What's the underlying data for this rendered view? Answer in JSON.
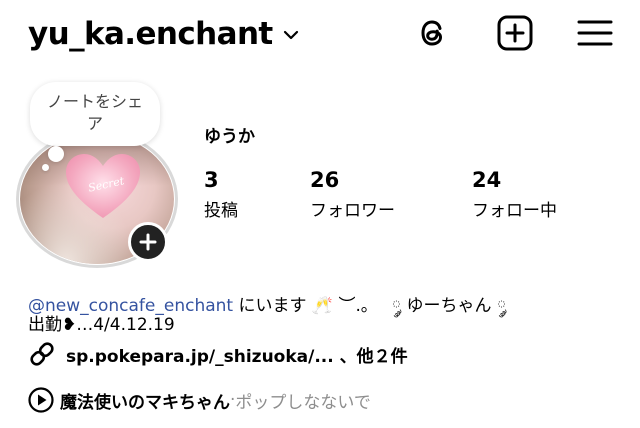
{
  "header": {
    "username": "yu_ka.enchant",
    "icons": [
      "chevron-down-icon",
      "threads-icon",
      "create-plus-icon",
      "menu-icon"
    ]
  },
  "note": {
    "line1": "ノートをシェ",
    "line2": "ア"
  },
  "avatar": {
    "overlay_text": "Secret",
    "add_story_icon": "plus-icon"
  },
  "profile": {
    "display_name": "ゆうか",
    "stats": [
      {
        "value": "3",
        "label": "投稿"
      },
      {
        "value": "26",
        "label": "フォロワー"
      },
      {
        "value": "24",
        "label": "フォロー中"
      }
    ]
  },
  "bio": {
    "mention": "@new_concafe_enchant",
    "line1_rest": " にいます 🥂 ︶.｡ 　༘ ゆーちゃん ༘",
    "line2": "出勤❥…4/4.12.19"
  },
  "link": {
    "icon": "link-icon",
    "text": "sp.pokepara.jp/_shizuoka/... 、他２件"
  },
  "music": {
    "icon": "play-circle-icon",
    "title": "魔法使いのマキちゃん",
    "separator": " · ",
    "subtitle": "ポップしなないで"
  },
  "colors": {
    "mention": "#3553a0",
    "secondary_text": "#8e8e8e",
    "avatar_ring": "#d9d9d9",
    "heart": "#f4a9c0"
  }
}
